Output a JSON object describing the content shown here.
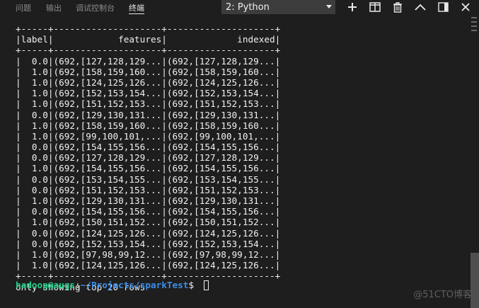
{
  "panel": {
    "tabs": [
      {
        "label": "问题",
        "active": false
      },
      {
        "label": "输出",
        "active": false
      },
      {
        "label": "调试控制台",
        "active": false
      },
      {
        "label": "终端",
        "active": true
      }
    ],
    "terminal_select": {
      "value": "2: Python"
    },
    "toolbar": [
      {
        "icon": "plus-icon"
      },
      {
        "icon": "split-terminal-icon"
      },
      {
        "icon": "trash-icon"
      },
      {
        "icon": "chevron-up-icon"
      },
      {
        "icon": "toggle-panel-icon"
      },
      {
        "icon": "close-icon"
      }
    ]
  },
  "terminal": {
    "lines": [
      "+-----+--------------------+--------------------+",
      "|label|            features|             indexed|",
      "+-----+--------------------+--------------------+",
      "|  0.0|(692,[127,128,129...|(692,[127,128,129...|",
      "|  1.0|(692,[158,159,160...|(692,[158,159,160...|",
      "|  1.0|(692,[124,125,126...|(692,[124,125,126...|",
      "|  1.0|(692,[152,153,154...|(692,[152,153,154...|",
      "|  1.0|(692,[151,152,153...|(692,[151,152,153...|",
      "|  0.0|(692,[129,130,131...|(692,[129,130,131...|",
      "|  1.0|(692,[158,159,160...|(692,[158,159,160...|",
      "|  1.0|(692,[99,100,101,...|(692,[99,100,101,...|",
      "|  0.0|(692,[154,155,156...|(692,[154,155,156...|",
      "|  0.0|(692,[127,128,129...|(692,[127,128,129...|",
      "|  1.0|(692,[154,155,156...|(692,[154,155,156...|",
      "|  0.0|(692,[153,154,155...|(692,[153,154,155...|",
      "|  0.0|(692,[151,152,153...|(692,[151,152,153...|",
      "|  1.0|(692,[129,130,131...|(692,[129,130,131...|",
      "|  0.0|(692,[154,155,156...|(692,[154,155,156...|",
      "|  1.0|(692,[150,151,152...|(692,[150,151,152...|",
      "|  0.0|(692,[124,125,126...|(692,[124,125,126...|",
      "|  0.0|(692,[152,153,154...|(692,[152,153,154...|",
      "|  1.0|(692,[97,98,99,12...|(692,[97,98,99,12...|",
      "|  1.0|(692,[124,125,126...|(692,[124,125,126...|",
      "+-----+--------------------+--------------------+",
      "only showing top 20 rows"
    ],
    "prompt": {
      "user_host": "hadoop@augs",
      "separator": ":",
      "path": "~/Projects/sparkTest",
      "symbol": "$ "
    }
  },
  "watermark": "@51CTO博客"
}
